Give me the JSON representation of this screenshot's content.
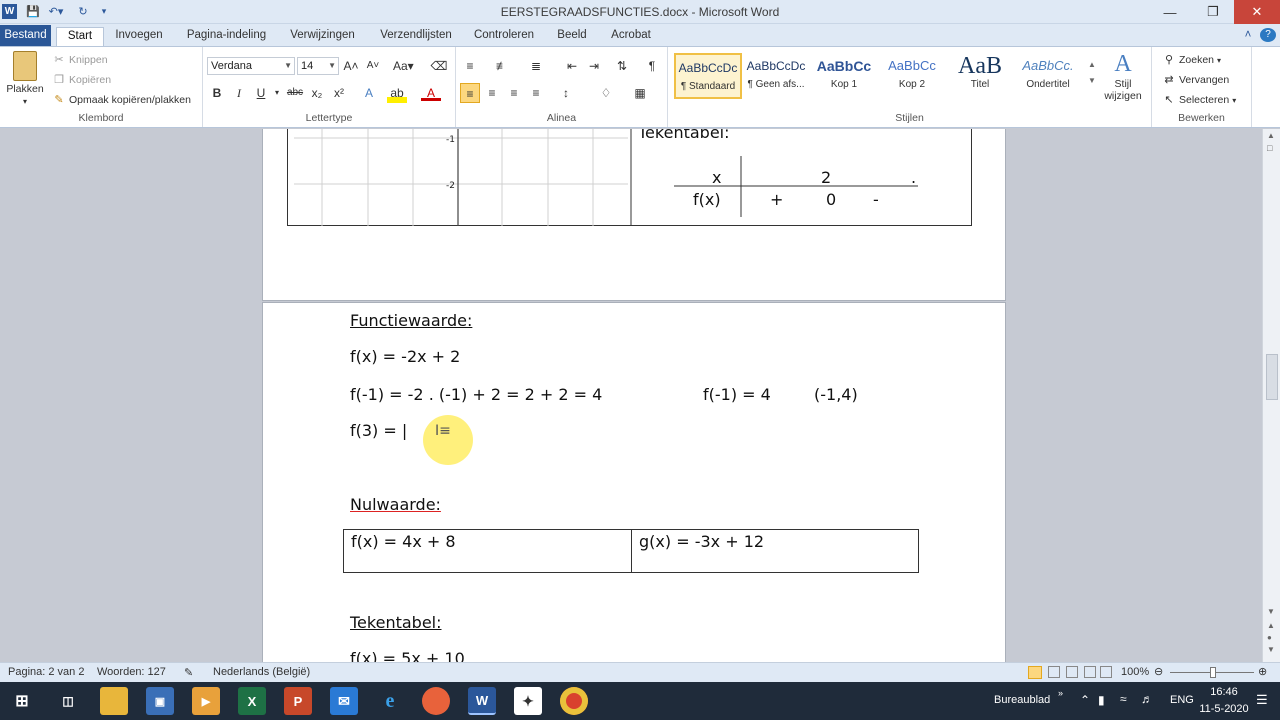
{
  "window": {
    "title": "EERSTEGRAADSFUNCTIES.docx - Microsoft Word",
    "app_letter": "W"
  },
  "tabs": [
    "Bestand",
    "Start",
    "Invoegen",
    "Pagina-indeling",
    "Verwijzingen",
    "Verzendlijsten",
    "Controleren",
    "Beeld",
    "Acrobat"
  ],
  "ribbon": {
    "clipboard": {
      "paste": "Plakken",
      "cut": "Knippen",
      "copy": "Kopiëren",
      "format_painter": "Opmaak kopiëren/plakken",
      "label": "Klembord"
    },
    "font": {
      "name": "Verdana",
      "size": "14",
      "label": "Lettertype"
    },
    "paragraph": {
      "label": "Alinea"
    },
    "styles": {
      "items": [
        {
          "preview": "AaBbCcDc",
          "name": "¶ Standaard"
        },
        {
          "preview": "AaBbCcDc",
          "name": "¶ Geen afs..."
        },
        {
          "preview": "AaBbCc",
          "name": "Kop 1"
        },
        {
          "preview": "AaBbCc",
          "name": "Kop 2"
        },
        {
          "preview": "AaB",
          "name": "Titel"
        },
        {
          "preview": "AaBbCc.",
          "name": "Ondertitel"
        }
      ],
      "change_line1": "Stijl",
      "change_line2": "wijzigen",
      "label": "Stijlen"
    },
    "editing": {
      "find": "Zoeken",
      "replace": "Vervangen",
      "select": "Selecteren",
      "label": "Bewerken"
    }
  },
  "document": {
    "page1": {
      "graph_ticks": [
        "-1",
        "-2"
      ],
      "sign_table_title": "Tekentabel:",
      "sign_table": {
        "x_label": "x",
        "x_value": "2",
        "x_dot": ".",
        "fx_label": "f(x)",
        "signs": [
          "+",
          "0",
          "-"
        ]
      }
    },
    "page2": {
      "heading1": "Functiewaarde:",
      "line1": "f(x) = -2x + 2",
      "line2": "f(-1) = -2 . (-1) + 2 = 2 + 2 = 4",
      "line2b": "f(-1) = 4",
      "line2c": "(-1,4)",
      "line3": "f(3) = |",
      "heading2": "Nulwaarde:",
      "table_cells": [
        "f(x) = 4x + 8",
        "g(x) = -3x + 12"
      ],
      "heading3": "Tekentabel:",
      "line4": "f(x) = 5x + 10"
    }
  },
  "status": {
    "page": "Pagina: 2 van 2",
    "words": "Woorden: 127",
    "language": "Nederlands (België)",
    "zoom": "100%"
  },
  "taskbar": {
    "desktop": "Bureaublad",
    "lang": "ENG",
    "time": "16:46",
    "date": "11-5-2020"
  }
}
